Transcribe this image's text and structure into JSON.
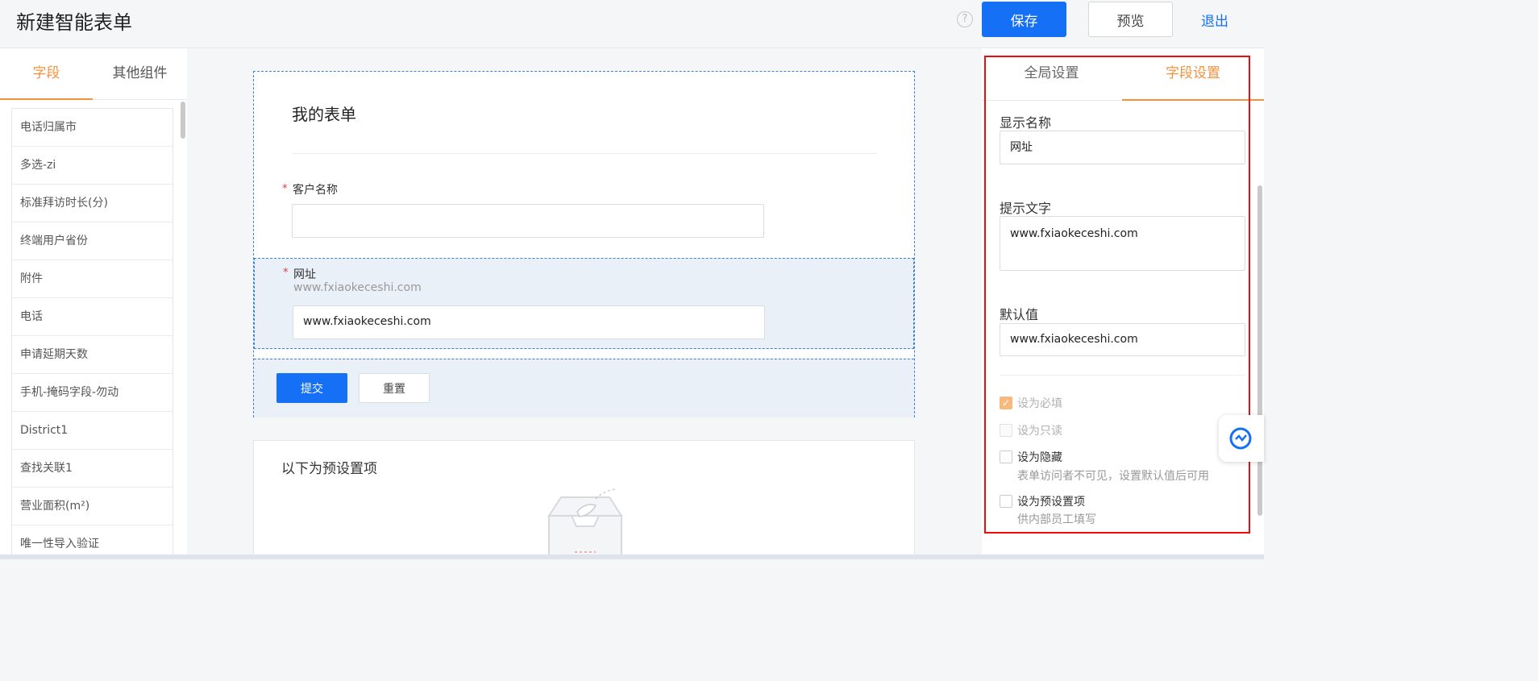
{
  "header": {
    "title": "新建智能表单",
    "help_icon": "?",
    "save_label": "保存",
    "preview_label": "预览",
    "exit_label": "退出"
  },
  "left_panel": {
    "tabs": [
      {
        "label": "字段",
        "active": true
      },
      {
        "label": "其他组件",
        "active": false
      }
    ],
    "fields": [
      "电话归属市",
      "多选-zi",
      "标准拜访时长(分)",
      "终端用户省份",
      "附件",
      "电话",
      "申请延期天数",
      "手机-掩码字段-勿动",
      "District1",
      "查找关联1",
      "营业面积(m²)",
      "唯一性导入验证"
    ]
  },
  "form": {
    "title": "我的表单",
    "fields": [
      {
        "label": "客户名称",
        "required": "*",
        "value": ""
      },
      {
        "label": "网址",
        "required": "*",
        "hint": "www.fxiaokeceshi.com",
        "value": "www.fxiaokeceshi.com"
      }
    ],
    "submit_label": "提交",
    "reset_label": "重置"
  },
  "preset": {
    "title": "以下为预设置项"
  },
  "right_panel": {
    "tabs": [
      {
        "label": "全局设置",
        "active": false
      },
      {
        "label": "字段设置",
        "active": true
      }
    ],
    "display_name_label": "显示名称",
    "display_name_value": "网址",
    "hint_text_label": "提示文字",
    "hint_text_value": "www.fxiaokeceshi.com",
    "default_value_label": "默认值",
    "default_value_value": "www.fxiaokeceshi.com",
    "options": [
      {
        "label": "设为必填",
        "checked": true,
        "disabled": true
      },
      {
        "label": "设为只读",
        "checked": false,
        "disabled": true
      },
      {
        "label": "设为隐藏",
        "checked": false,
        "disabled": false,
        "desc": "表单访问者不可见，设置默认值后可用"
      },
      {
        "label": "设为预设置项",
        "checked": false,
        "disabled": false,
        "desc": "供内部员工填写"
      }
    ]
  },
  "colors": {
    "primary": "#1570f6",
    "accent_orange": "#f5913d",
    "highlight_red": "#f40a0a"
  }
}
